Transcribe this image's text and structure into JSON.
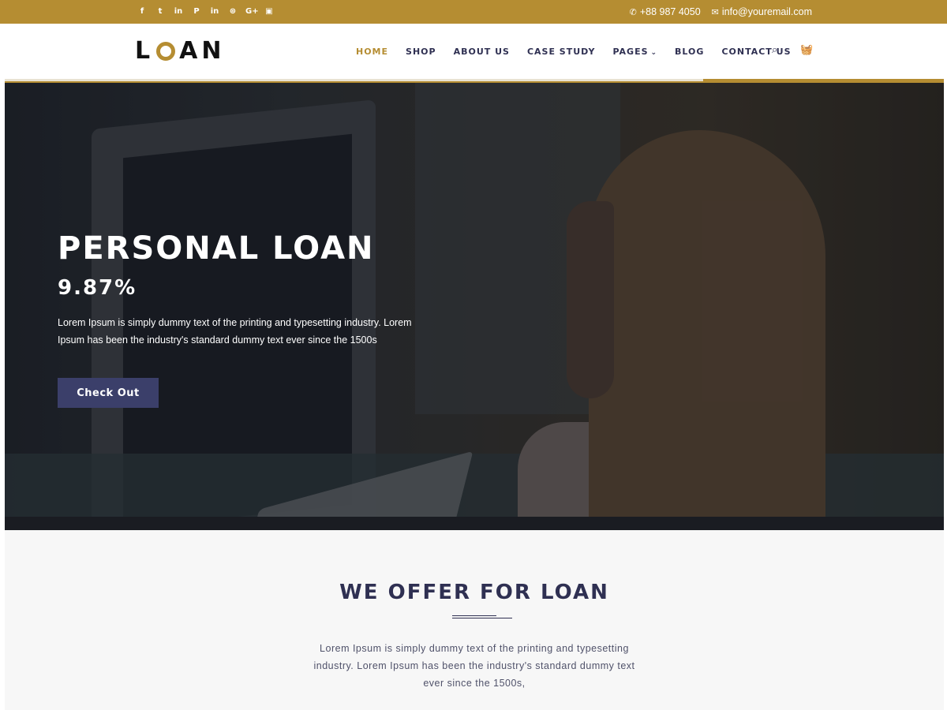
{
  "topbar": {
    "social": [
      {
        "icon": "facebook-icon",
        "glyph": "f"
      },
      {
        "icon": "twitter-icon",
        "glyph": "t"
      },
      {
        "icon": "linkedin-icon",
        "glyph": "in"
      },
      {
        "icon": "pinterest-icon",
        "glyph": "P"
      },
      {
        "icon": "linkedin-icon",
        "glyph": "in"
      },
      {
        "icon": "dribbble-icon",
        "glyph": "⊛"
      },
      {
        "icon": "google-plus-icon",
        "glyph": "G+"
      },
      {
        "icon": "youtube-icon",
        "glyph": "▣"
      }
    ],
    "phone": "+88 987 4050",
    "email": "info@youremail.com",
    "phone_icon": "✆",
    "email_icon": "✉"
  },
  "header": {
    "logo_left": "L",
    "logo_right": "AN",
    "nav": {
      "home": "HOME",
      "shop": "SHOP",
      "about": "ABOUT US",
      "case_study": "CASE STUDY",
      "pages": "PAGES",
      "blog": "BLOG",
      "contact": "CONTACT US"
    },
    "search_icon": "⌕",
    "cart_icon": "🧺"
  },
  "hero": {
    "title": "PERSONAL LOAN",
    "rate": "9.87%",
    "text": "Lorem Ipsum is simply dummy text of the printing and typesetting industry. Lorem Ipsum has been the industry's standard dummy text ever since the 1500s",
    "button": "Check Out"
  },
  "offer": {
    "title": "WE OFFER FOR LOAN",
    "text": "Lorem Ipsum is simply dummy text of the printing and typesetting industry. Lorem Ipsum has been the industry's standard dummy text ever since the 1500s,"
  },
  "colors": {
    "accent": "#b58d32",
    "navy": "#2f3052",
    "button": "#3b3f6a"
  }
}
